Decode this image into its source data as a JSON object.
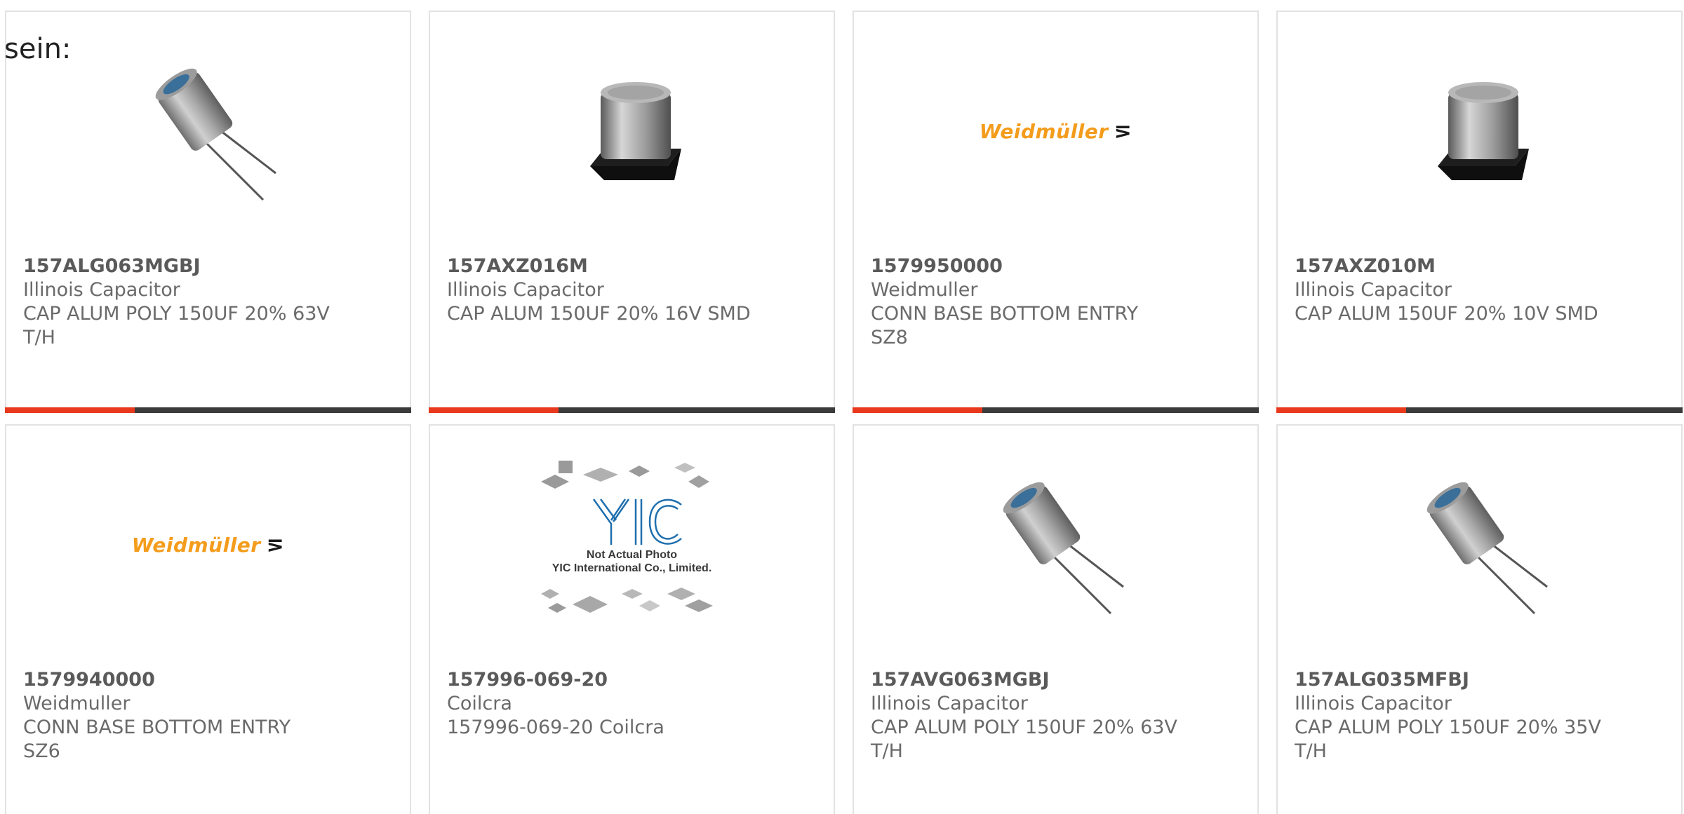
{
  "heading": "sein:",
  "products": [
    {
      "part": "157ALG063MGBJ",
      "maker": "Illinois Capacitor",
      "desc": "CAP ALUM POLY 150UF 20% 63V T/H",
      "image": "radial-capacitor-icon",
      "progress": 0.32
    },
    {
      "part": "157AXZ016M",
      "maker": "Illinois Capacitor",
      "desc": "CAP ALUM 150UF 20% 16V SMD",
      "image": "smd-capacitor-icon",
      "progress": 0.32
    },
    {
      "part": "1579950000",
      "maker": "Weidmuller",
      "desc": "CONN BASE BOTTOM ENTRY SZ8",
      "image": "weidmuller-logo",
      "logo_text": "Weidmüller",
      "progress": 0.32
    },
    {
      "part": "157AXZ010M",
      "maker": "Illinois Capacitor",
      "desc": "CAP ALUM 150UF 20% 10V SMD",
      "image": "smd-capacitor-icon",
      "progress": 0.32
    },
    {
      "part": "1579940000",
      "maker": "Weidmuller",
      "desc": "CONN BASE BOTTOM ENTRY SZ6",
      "image": "weidmuller-logo",
      "logo_text": "Weidmüller"
    },
    {
      "part": "157996-069-20",
      "maker": "Coilcra",
      "desc": "157996-069-20 Coilcra",
      "image": "yic-placeholder",
      "placeholder_line1": "Not Actual Photo",
      "placeholder_line2": "YIC International Co., Limited."
    },
    {
      "part": "157AVG063MGBJ",
      "maker": "Illinois Capacitor",
      "desc": "CAP ALUM POLY 150UF 20% 63V T/H",
      "image": "radial-capacitor-icon"
    },
    {
      "part": "157ALG035MFBJ",
      "maker": "Illinois Capacitor",
      "desc": "CAP ALUM POLY 150UF 20% 35V T/H",
      "image": "radial-capacitor-icon"
    }
  ],
  "colors": {
    "accent": "#e8391d",
    "bar": "#3b3b3b",
    "border": "#e2e2e2",
    "text": "#6a6a6a",
    "weidmuller": "#f49c1c"
  }
}
